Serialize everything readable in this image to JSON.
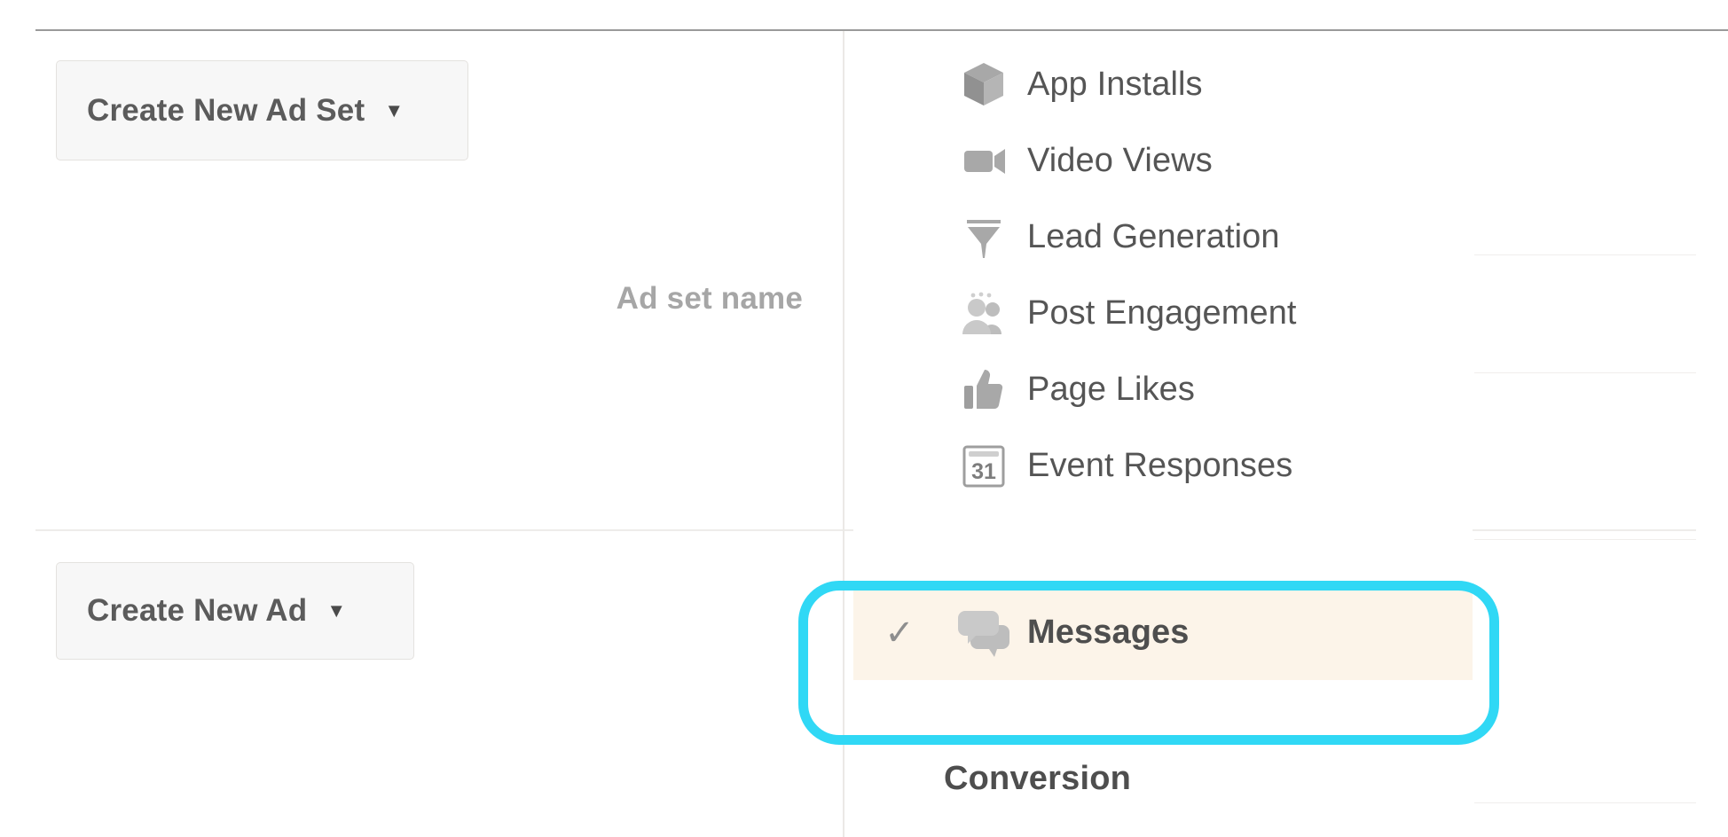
{
  "page": {
    "background_color": "#ffffff",
    "annotation_color": "#30d8f5",
    "selected_row_color": "#fcf4e9"
  },
  "left_panel": {
    "create_ad_set_button": {
      "label": "Create New Ad Set",
      "caret": "▼",
      "icon_name": "chevron-down-icon"
    },
    "ad_set_name_label": "Ad set name",
    "create_ad_button": {
      "label": "Create New Ad",
      "caret": "▼",
      "icon_name": "chevron-down-icon"
    }
  },
  "dropdown": {
    "items": [
      {
        "label": "App Installs",
        "icon": "cube-icon",
        "selected": false,
        "check": ""
      },
      {
        "label": "Video Views",
        "icon": "video-camera-icon",
        "selected": false,
        "check": ""
      },
      {
        "label": "Lead Generation",
        "icon": "funnel-icon",
        "selected": false,
        "check": ""
      },
      {
        "label": "Post Engagement",
        "icon": "people-icon",
        "selected": false,
        "check": ""
      },
      {
        "label": "Page Likes",
        "icon": "thumbs-up-icon",
        "selected": false,
        "check": ""
      },
      {
        "label": "Event Responses",
        "icon": "calendar-31-icon",
        "selected": false,
        "check": ""
      },
      {
        "label": "Messages",
        "icon": "chat-bubbles-icon",
        "selected": true,
        "check": "✓"
      }
    ],
    "section_header": "Conversion"
  }
}
